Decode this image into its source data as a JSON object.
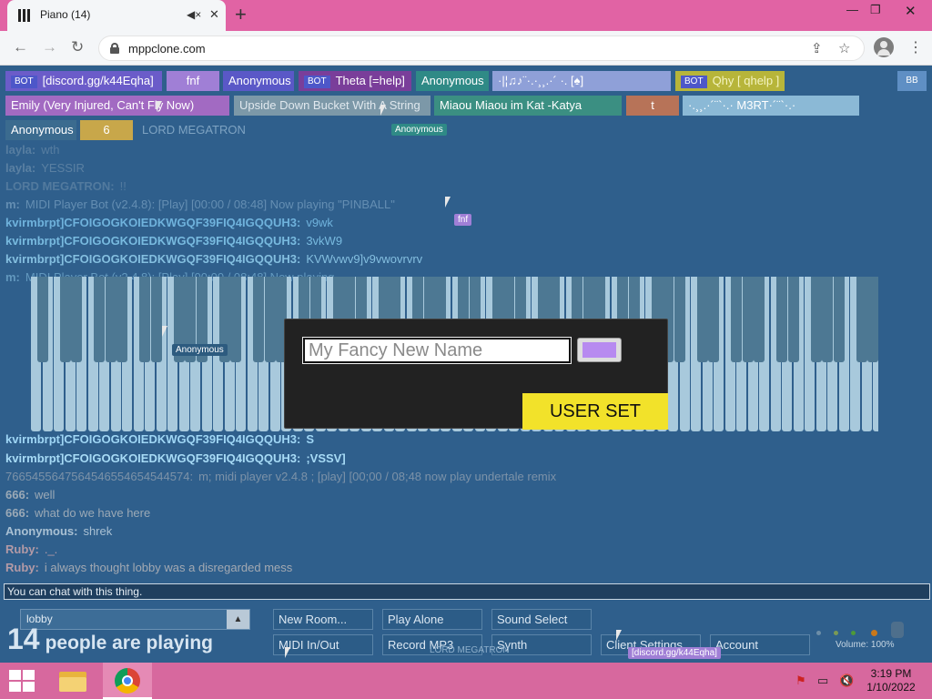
{
  "browser": {
    "tab_title": "Piano (14)",
    "url": "mppclone.com",
    "new_tab": "+",
    "minimize": "—",
    "restore": "❐",
    "close": "✕"
  },
  "users_row1": [
    {
      "bot": true,
      "name": "[discord.gg/k44Eqha]",
      "color": "#6b5cc9"
    },
    {
      "bot": false,
      "name": "fnf",
      "color": "#a07fd6"
    },
    {
      "bot": false,
      "name": "Anonymous",
      "color": "#5a58c7"
    },
    {
      "bot": true,
      "name": "Theta [=help]",
      "color": "#7a3e9a"
    },
    {
      "bot": false,
      "name": "Anonymous",
      "color": "#2f8a86"
    },
    {
      "bot": false,
      "name": "·|¦♫♪¨·.·¸¸.·´ ·. [♠]",
      "color": "#8fa0d8"
    },
    {
      "bot": true,
      "name": "Qhy [ qhelp ]",
      "color": "#b7b53a"
    }
  ],
  "users_row2": [
    {
      "name": "Emily (Very Injured, Can't Fly Now)",
      "color": "#a26ac2"
    },
    {
      "name": "Upside Down Bucket With A String",
      "color": "#7c98a8"
    },
    {
      "name": "Miaou Miaou im Kat -Katya",
      "color": "#3b8f82"
    },
    {
      "name": "t",
      "color": "#b77358"
    },
    {
      "name": "·.¸¸.·´¨`·.·  M3RT·´¨`·.·",
      "color": "#8bb9d6"
    }
  ],
  "users_row3": [
    {
      "name": "Anonymous",
      "color": "#3b6b8f"
    },
    {
      "name": "6",
      "color": "#c8a74a"
    },
    {
      "name": "LORD MEGATRON",
      "color": "transparent"
    }
  ],
  "bb_badge": "BB",
  "floating_tags": {
    "anonymous_1": "Anonymous",
    "anonymous_2": "Anonymous",
    "fnf": "fnf",
    "lord": "LORD MEGATRON",
    "discord": "[discord.gg/k44Eqha]"
  },
  "chat": [
    {
      "name": "layla:",
      "text": "wth",
      "color": "#3d6a8f"
    },
    {
      "name": "layla:",
      "text": "YESSIR",
      "color": "#3d6a8f"
    },
    {
      "name": "LORD MEGATRON:",
      "text": "!!",
      "color": "#3d6a8f"
    },
    {
      "name": "m:",
      "text": "MIDI Player Bot (v2.4.8): [Play] [00:00 / 08:48] Now playing \"PINBALL\"",
      "color": "#4c7aa0"
    },
    {
      "name": "kvirmbrpt]CFOIGOGKOIEDKWGQF39FIQ4IGQQUH3:",
      "text": "v9wk",
      "color": "#65a9d4"
    },
    {
      "name": "kvirmbrpt]CFOIGOGKOIEDKWGQF39FIQ4IGQQUH3:",
      "text": "3vkW9",
      "color": "#6fb2dc"
    },
    {
      "name": "kvirmbrpt]CFOIGOGKOIEDKWGQF39FIQ4IGQQUH3:",
      "text": "KVWvwv9]v9vwovrvrv",
      "color": "#78badf"
    },
    {
      "name": "m:",
      "text": "MIDI Player Bot (v2.4.8): [Play] [00:00 / 08:48] Now playing",
      "color": "#84bfe0"
    },
    {
      "name": "kvirmbrpt]CFOIGOGKOIEDKWGQF39FIQ4IGQQUH3:",
      "text": "S",
      "color": "#9fd6f5"
    },
    {
      "name": "kvirmbrpt]CFOIGOGKOIEDKWGQF39FIQ4IGQQUH3:",
      "text": ";VSSV]",
      "color": "#a7dbf6"
    },
    {
      "name": "7665455647564546554654544574:",
      "text": "m; midi player v2.4.8 ; [play] [00;00 / 08;48 now play undertale remix",
      "color": "#7c92a8"
    },
    {
      "name": "666:",
      "text": "well",
      "color": "#8aa0b3"
    },
    {
      "name": "666:",
      "text": "what do we have here",
      "color": "#8aa0b3"
    },
    {
      "name": "Anonymous:",
      "text": "shrek",
      "color": "#9db6c9"
    },
    {
      "name": "Ruby:",
      "text": "._.",
      "color": "#b08a9a"
    },
    {
      "name": "Ruby:",
      "text": "i always thought lobby was a disregarded mess",
      "color": "#b08a9a"
    }
  ],
  "modal": {
    "placeholder": "My Fancy New Name",
    "color_value": "#b78af0",
    "button_label": "USER SET"
  },
  "chat_input_placeholder": "You can chat with this thing.",
  "room": {
    "name": "lobby",
    "arrow": "▲"
  },
  "people": {
    "count": "14",
    "label": "people are playing"
  },
  "controls": {
    "new_room": "New Room...",
    "play_alone": "Play Alone",
    "sound_select": "Sound Select",
    "midi": "MIDI In/Out",
    "record": "Record MP3",
    "synth": "Synth",
    "client_settings": "Client Settings",
    "account": "Account",
    "volume": "Volume: 100%"
  },
  "taskbar": {
    "time": "3:19 PM",
    "date": "1/10/2022"
  }
}
